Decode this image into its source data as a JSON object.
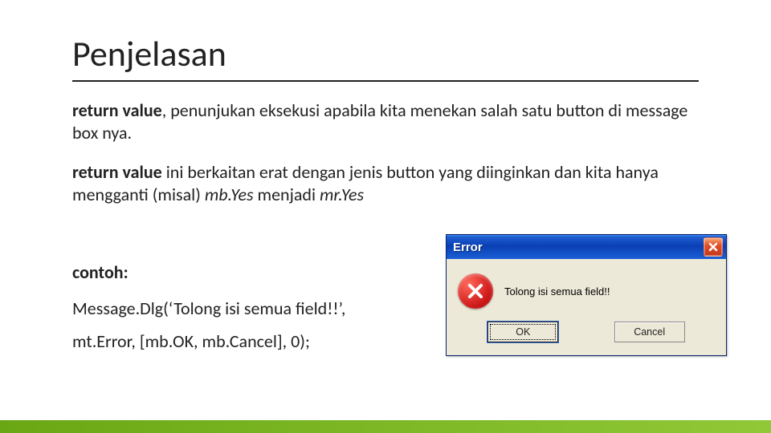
{
  "title": "Penjelasan",
  "p1": {
    "bold": "return value",
    "rest": ", penunjukan eksekusi apabila kita menekan salah satu button di message box nya."
  },
  "p2": {
    "bold": "return value",
    "mid": " ini berkaitan erat dengan jenis button yang diinginkan dan kita hanya mengganti (misal) ",
    "it1": "mb.Yes",
    "mid2": " menjadi ",
    "it2": "mr.Yes"
  },
  "contoh_label": "contoh:",
  "code_line1": "Message.Dlg(‘Tolong isi semua field!!’,",
  "code_line2": " mt.Error, [mb.OK, mb.Cancel], 0);",
  "dialog": {
    "title": "Error",
    "message": "Tolong isi semua field!!",
    "ok_label": "OK",
    "cancel_label": "Cancel"
  }
}
